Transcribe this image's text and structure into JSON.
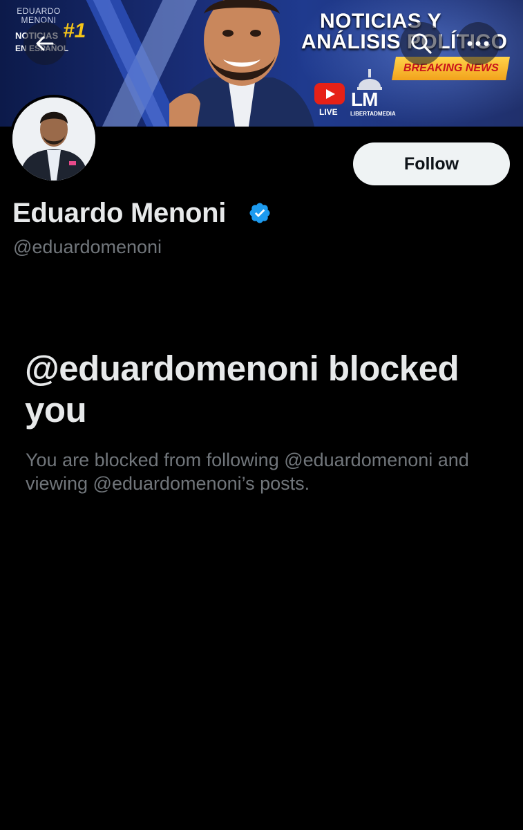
{
  "banner": {
    "brand_name": "EDUARDO MENONI",
    "brand_noticias": "NOTICIAS",
    "brand_rank": "#1",
    "brand_lang": "EN ESPAÑOL",
    "headline_line1": "NOTICIAS Y",
    "headline_line2": "ANÁLISIS POLÍTICO",
    "breaking": "BREAKING NEWS",
    "live_label": "LIVE",
    "lm_letters": "LM",
    "lm_name": "LIBERTADMEDIA"
  },
  "icons": {
    "back": "arrow-left-icon",
    "search": "search-icon",
    "more": "more-horizontal-icon",
    "verified": "verified-badge-icon"
  },
  "profile": {
    "display_name": "Eduardo Menoni",
    "handle": "@eduardomenoni",
    "follow_label": "Follow"
  },
  "blocked": {
    "title": "@eduardomenoni blocked you",
    "description": "You are blocked from following @eduardomenoni and viewing @eduardomenoni’s posts."
  },
  "colors": {
    "background": "#000000",
    "primary_text": "#e7e9ea",
    "secondary_text": "#71767b",
    "verified_blue": "#1d9bf0",
    "follow_button_bg": "#eff3f4"
  }
}
